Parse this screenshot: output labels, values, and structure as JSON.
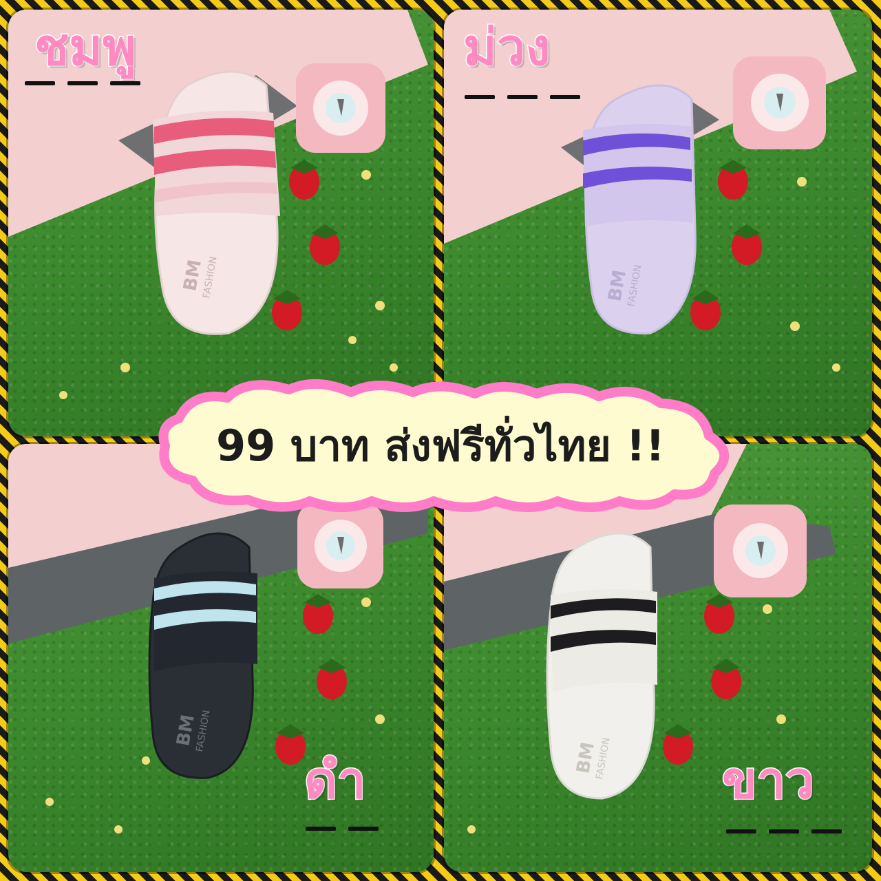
{
  "panels": {
    "top_left": {
      "color_label": "ชมพู",
      "brand": "BM",
      "brand_sub": "FASHION"
    },
    "top_right": {
      "color_label": "ม่วง",
      "brand": "BM",
      "brand_sub": "FASHION"
    },
    "bottom_left": {
      "color_label": "ดำ",
      "brand": "BM",
      "brand_sub": "FASHION"
    },
    "bottom_right": {
      "color_label": "ขาว",
      "brand": "BM",
      "brand_sub": "FASHION"
    }
  },
  "banner": {
    "text": "99 บาท ส่งฟรีทั่วไทย !!"
  },
  "colors": {
    "label_pink": "#ff8ac2",
    "banner_fill": "#fffbd0",
    "banner_border": "#ff7cc8",
    "grass": "#3d8a2e",
    "border_yellow": "#f3cb18",
    "border_black": "#1a1a1a"
  }
}
